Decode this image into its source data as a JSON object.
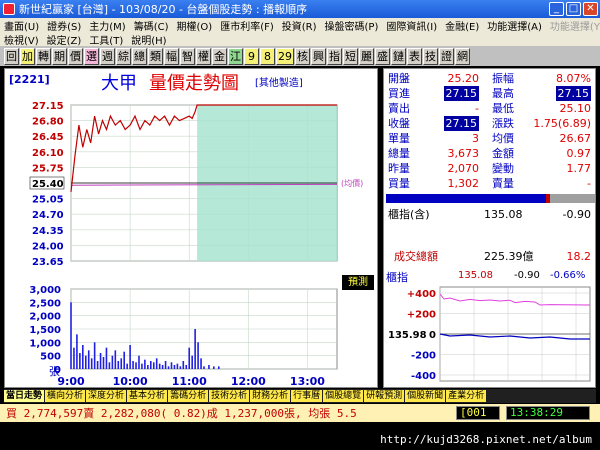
{
  "titlebar": {
    "title": "新世紀贏家 [台灣] - 103/08/20 - 台盤個股走勢 : 播報順序",
    "buttons": [
      "_",
      "□",
      "✕"
    ]
  },
  "menubar": {
    "row1": [
      "畫面(U)",
      "證券(S)",
      "主力(M)",
      "籌碼(C)",
      "期權(O)",
      "匯市利率(F)",
      "投資(R)",
      "操盤密碼(P)",
      "國際資訊(I)",
      "金融(E)",
      "功能選擇(A)"
    ],
    "row1_dim": [
      "功能選擇(Y)"
    ],
    "row2": [
      "檢視(V)",
      "設定(Z)",
      "工具(T)",
      "說明(H)"
    ]
  },
  "toolbar": {
    "buttons": [
      "回",
      "加",
      "轉",
      "期",
      "價",
      "選",
      "週",
      "綜",
      "總",
      "類",
      "幅",
      "智",
      "權",
      "金",
      "江",
      "9",
      "8",
      "29",
      "核",
      "興",
      "指",
      "短",
      "麗",
      "盛",
      "鏈",
      "表",
      "技",
      "證",
      "網"
    ]
  },
  "chart": {
    "code": "[2221]",
    "name": "大甲",
    "title": "量價走勢圖",
    "industry": "[其他製造]",
    "predict_label": "預測",
    "ref_label": "(均價)",
    "volume_unit": "張"
  },
  "chart_data": {
    "type": "line",
    "y_ticks": [
      "27.15",
      "26.80",
      "26.45",
      "26.10",
      "25.75",
      "25.40",
      "25.05",
      "24.70",
      "24.35",
      "24.00",
      "23.65"
    ],
    "vol_ticks": [
      "3,000",
      "2,500",
      "2,000",
      "1,500",
      "1,000",
      "500",
      "0"
    ],
    "x_ticks": [
      "9:00",
      "10:00",
      "11:00",
      "12:00",
      "13:00"
    ],
    "ylim": [
      23.65,
      27.15
    ],
    "reference_price": 25.4,
    "avg_price": 25.35,
    "time_axis": [
      "09:00",
      "13:30"
    ],
    "price_series": [
      [
        "09:00",
        25.2
      ],
      [
        "09:04",
        26.0
      ],
      [
        "09:08",
        26.7
      ],
      [
        "09:12",
        26.2
      ],
      [
        "09:16",
        26.6
      ],
      [
        "09:20",
        26.3
      ],
      [
        "09:24",
        26.9
      ],
      [
        "09:28",
        26.5
      ],
      [
        "09:32",
        26.8
      ],
      [
        "09:36",
        26.6
      ],
      [
        "09:40",
        26.9
      ],
      [
        "09:45",
        26.7
      ],
      [
        "09:50",
        26.8
      ],
      [
        "09:55",
        26.6
      ],
      [
        "10:00",
        26.7
      ],
      [
        "10:05",
        26.9
      ],
      [
        "10:10",
        26.6
      ],
      [
        "10:15",
        26.8
      ],
      [
        "10:20",
        26.7
      ],
      [
        "10:25",
        26.9
      ],
      [
        "10:30",
        26.8
      ],
      [
        "10:35",
        26.9
      ],
      [
        "10:40",
        26.7
      ],
      [
        "10:45",
        26.9
      ],
      [
        "10:50",
        26.8
      ],
      [
        "10:55",
        26.85
      ],
      [
        "11:00",
        26.9
      ],
      [
        "11:03",
        26.85
      ],
      [
        "11:06",
        27.0
      ],
      [
        "11:08",
        27.15
      ],
      [
        "11:15",
        27.15
      ],
      [
        "11:30",
        27.15
      ],
      [
        "12:00",
        27.15
      ],
      [
        "12:30",
        27.15
      ],
      [
        "13:00",
        27.15
      ],
      [
        "13:30",
        27.15
      ]
    ],
    "volume_series": [
      [
        "09:00",
        2500
      ],
      [
        "09:03",
        800
      ],
      [
        "09:06",
        1300
      ],
      [
        "09:09",
        600
      ],
      [
        "09:12",
        900
      ],
      [
        "09:15",
        500
      ],
      [
        "09:18",
        700
      ],
      [
        "09:21",
        400
      ],
      [
        "09:24",
        1000
      ],
      [
        "09:27",
        300
      ],
      [
        "09:30",
        600
      ],
      [
        "09:33",
        450
      ],
      [
        "09:36",
        800
      ],
      [
        "09:39",
        250
      ],
      [
        "09:42",
        500
      ],
      [
        "09:45",
        700
      ],
      [
        "09:48",
        300
      ],
      [
        "09:51",
        400
      ],
      [
        "09:54",
        650
      ],
      [
        "09:57",
        200
      ],
      [
        "10:00",
        900
      ],
      [
        "10:03",
        300
      ],
      [
        "10:06",
        250
      ],
      [
        "10:09",
        500
      ],
      [
        "10:12",
        200
      ],
      [
        "10:15",
        350
      ],
      [
        "10:18",
        150
      ],
      [
        "10:21",
        300
      ],
      [
        "10:24",
        250
      ],
      [
        "10:27",
        400
      ],
      [
        "10:30",
        200
      ],
      [
        "10:33",
        150
      ],
      [
        "10:36",
        300
      ],
      [
        "10:39",
        100
      ],
      [
        "10:42",
        250
      ],
      [
        "10:45",
        150
      ],
      [
        "10:48",
        200
      ],
      [
        "10:51",
        100
      ],
      [
        "10:54",
        300
      ],
      [
        "10:57",
        150
      ],
      [
        "11:00",
        800
      ],
      [
        "11:03",
        500
      ],
      [
        "11:06",
        1500
      ],
      [
        "11:09",
        1000
      ],
      [
        "11:12",
        400
      ],
      [
        "11:15",
        100
      ],
      [
        "11:20",
        150
      ],
      [
        "11:25",
        100
      ],
      [
        "11:30",
        100
      ]
    ]
  },
  "quote": {
    "rows": [
      {
        "l1": "開盤",
        "v1": "25.20",
        "l2": "振幅",
        "v2": "8.07%"
      },
      {
        "l1": "買進",
        "v1": "27.15",
        "l2": "最高",
        "v2": "27.15"
      },
      {
        "l1": "賣出",
        "v1": "-",
        "l2": "最低",
        "v2": "25.10"
      },
      {
        "l1": "收盤",
        "v1": "27.15",
        "l2": "漲跌",
        "v2": "1.75(6.89)"
      },
      {
        "l1": "單量",
        "v1": "3",
        "l2": "均價",
        "v2": "26.67"
      },
      {
        "l1": "總量",
        "v1": "3,673",
        "l2": "金額",
        "v2": "0.97"
      },
      {
        "l1": "昨量",
        "v1": "2,070",
        "l2": "變動",
        "v2": "1.77"
      },
      {
        "l1": "買量",
        "v1": "1,302",
        "l2": "賣量",
        "v2": "-"
      }
    ],
    "index_label": "櫃指(含)",
    "index_value": "135.08",
    "index_change": "-0.90",
    "turnover_label": "成交總額",
    "turnover_value": "225.39億",
    "turnover_extra": "18.2"
  },
  "mini_chart": {
    "title": "櫃指",
    "value": "135.08",
    "change": "-0.90",
    "pct": "-0.66%",
    "ref_label": "135.98",
    "y_ticks": [
      "+400",
      "+200",
      "0",
      "-200",
      "-400"
    ],
    "x_ticks": [
      "9",
      "10",
      "11",
      "12",
      "1"
    ]
  },
  "tabs": [
    "當日走勢",
    "橫向分析",
    "深度分析",
    "基本分析",
    "籌碼分析",
    "技術分析",
    "財務分析",
    "行事曆",
    "個股總覽",
    "研報預測",
    "個股新聞",
    "產業分析"
  ],
  "status": {
    "text": "買 2,774,597賣 2,282,080( 0.82)成 1,237,000張, 均張 5.5",
    "code": "[001",
    "time": "13:38:29"
  },
  "watermark": "http://kujd3268.pixnet.net/album"
}
